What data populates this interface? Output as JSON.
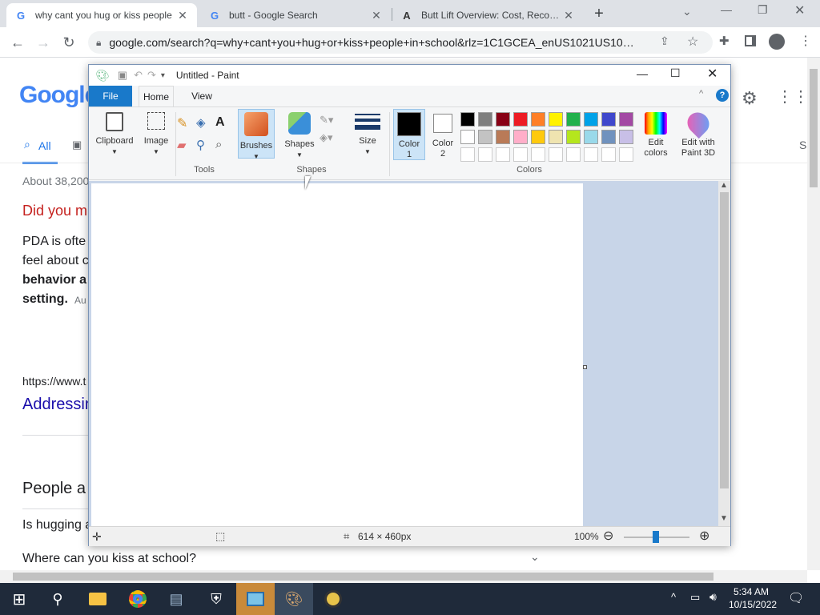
{
  "browser": {
    "tabs": [
      {
        "title": "why cant you hug or kiss people",
        "favicon": "G",
        "active": true
      },
      {
        "title": "butt - Google Search",
        "favicon": "G",
        "active": false
      },
      {
        "title": "Butt Lift Overview: Cost, Recover",
        "favicon": "A",
        "active": false
      }
    ],
    "new_tab": "+",
    "url": "google.com/search?q=why+cant+you+hug+or+kiss+people+in+school&rlz=1C1GCEA_enUS1021US1021..."
  },
  "google": {
    "logo": "Google",
    "tab_all": "All",
    "result_count": "About 38,200",
    "did_you_mean": "Did you m",
    "snippet_lines": [
      "PDA is ofte",
      "feel about c",
      "behavior a",
      "setting."
    ],
    "snippet_tail": "Au",
    "result_url": "https://www.t",
    "result_title": "Addressin",
    "people_also_ask": "People a",
    "paa_items": [
      "Is hugging a",
      "Where can you kiss at school?"
    ],
    "right_tab": "S"
  },
  "paint": {
    "title": "Untitled - Paint",
    "menu_tabs": [
      "File",
      "Home",
      "View"
    ],
    "groups": {
      "clipboard": "Clipboard",
      "image": "Image",
      "tools": "Tools",
      "brushes": "Brushes",
      "shapes": "Shapes",
      "shapes_label": "Shapes",
      "size": "Size",
      "color1": "Color 1",
      "color2": "Color 2",
      "colors": "Colors",
      "edit_colors": "Edit colors",
      "paint3d": "Edit with Paint 3D"
    },
    "palette_row1": [
      "#000000",
      "#7f7f7f",
      "#880015",
      "#ed1c24",
      "#ff7f27",
      "#fff200",
      "#22b14c",
      "#00a2e8",
      "#3f48cc",
      "#a349a4"
    ],
    "palette_row2": [
      "#ffffff",
      "#c3c3c3",
      "#b97a57",
      "#ffaec9",
      "#ffc90e",
      "#efe4b0",
      "#b5e61d",
      "#99d9ea",
      "#7092be",
      "#c8bfe7"
    ],
    "canvas_size": "614 × 460px",
    "zoom": "100%"
  },
  "taskbar": {
    "time": "5:34 AM",
    "date": "10/15/2022"
  }
}
